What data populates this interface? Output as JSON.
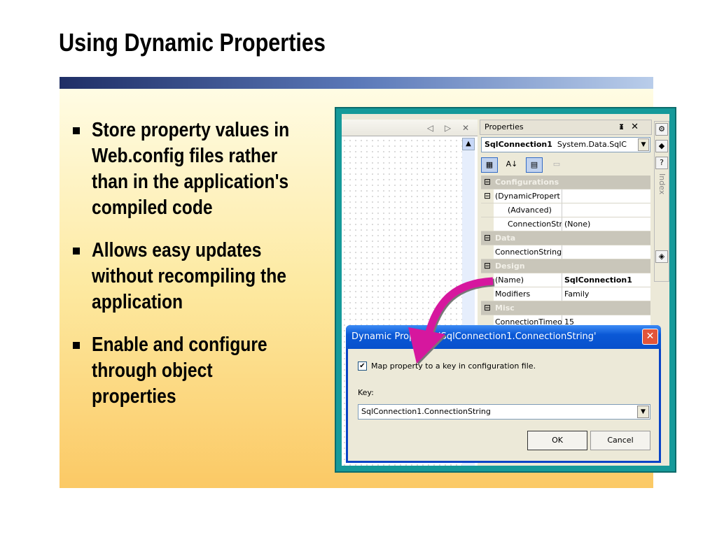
{
  "slide": {
    "title": "Using Dynamic Properties",
    "bullets": [
      {
        "lines": [
          "Store property values in",
          "Web.config files rather",
          "than in the application's",
          "compiled code"
        ]
      },
      {
        "lines": [
          "Allows easy updates",
          "without recompiling the",
          "application"
        ]
      },
      {
        "lines": [
          "Enable and configure",
          "through object",
          "properties"
        ]
      }
    ]
  },
  "designer": {
    "nav": "◁ ▷ ✕"
  },
  "properties": {
    "title": "Properties",
    "pin": "ᵻ",
    "close": "✕",
    "object_name": "SqlConnection1",
    "object_type": "System.Data.SqlC",
    "rows": [
      {
        "type": "cat",
        "label": "Configurations"
      },
      {
        "type": "group",
        "label": "(DynamicPropert",
        "value": ""
      },
      {
        "type": "ind",
        "label": "(Advanced)",
        "value": ""
      },
      {
        "type": "ind",
        "label": "ConnectionStr",
        "value": "(None)"
      },
      {
        "type": "cat",
        "label": "Data"
      },
      {
        "type": "prop",
        "label": "ConnectionString",
        "value": ""
      },
      {
        "type": "cat",
        "label": "Design"
      },
      {
        "type": "prop",
        "label": "(Name)",
        "value": "SqlConnection1"
      },
      {
        "type": "prop",
        "label": "Modifiers",
        "value": "Family"
      },
      {
        "type": "cat",
        "label": "Misc"
      },
      {
        "type": "prop",
        "label": "ConnectionTimeout",
        "value": "15"
      }
    ],
    "side_tab": "Index"
  },
  "dialog": {
    "title": "Dynamic Property: 'SqlConnection1.ConnectionString'",
    "checkbox_label": "Map property to a key in configuration file.",
    "checked": true,
    "key_label": "Key:",
    "key_value": "SqlConnection1.ConnectionString",
    "ok": "OK",
    "cancel": "Cancel"
  },
  "colors": {
    "accent_arrow": "#d6179e",
    "frame": "#159a9a"
  }
}
